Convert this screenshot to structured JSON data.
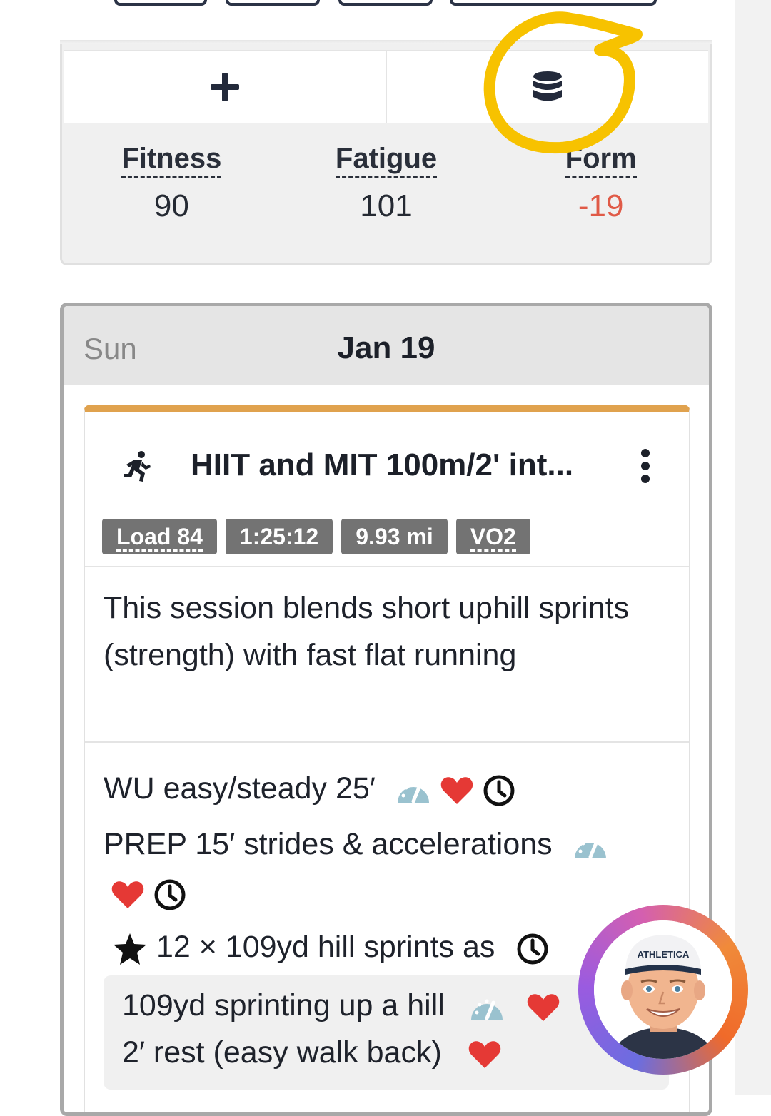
{
  "summary": {
    "actions": [
      {
        "name": "add",
        "icon": "plus-icon"
      },
      {
        "name": "data",
        "icon": "database-icon"
      }
    ],
    "stats": [
      {
        "label": "Fitness",
        "value": "90"
      },
      {
        "label": "Fatigue",
        "value": "101"
      },
      {
        "label": "Form",
        "value": "-19"
      }
    ]
  },
  "day": {
    "name": "Sun",
    "date": "Jan 19"
  },
  "workout": {
    "title": "HIIT and MIT 100m/2' int...",
    "accent_color": "#e0a24e",
    "badges": {
      "load": "Load 84",
      "duration": "1:25:12",
      "distance": "9.93 mi",
      "zone": "VO2"
    },
    "description": "This session blends short uphill sprints (strength) with fast flat running",
    "steps": {
      "warmup": "WU easy/steady 25′",
      "prep": "PREP 15′ strides & accelerations",
      "main": "12 × 109yd hill sprints as",
      "sub1": "109yd sprinting up a hill",
      "sub2": "2′ rest (easy walk back)"
    }
  },
  "coach": {
    "cap_text": "ATHLETICA"
  },
  "colors": {
    "negative": "#e05a47",
    "badge": "#737373",
    "heart": "#e53935",
    "annotation": "#f7c200"
  }
}
